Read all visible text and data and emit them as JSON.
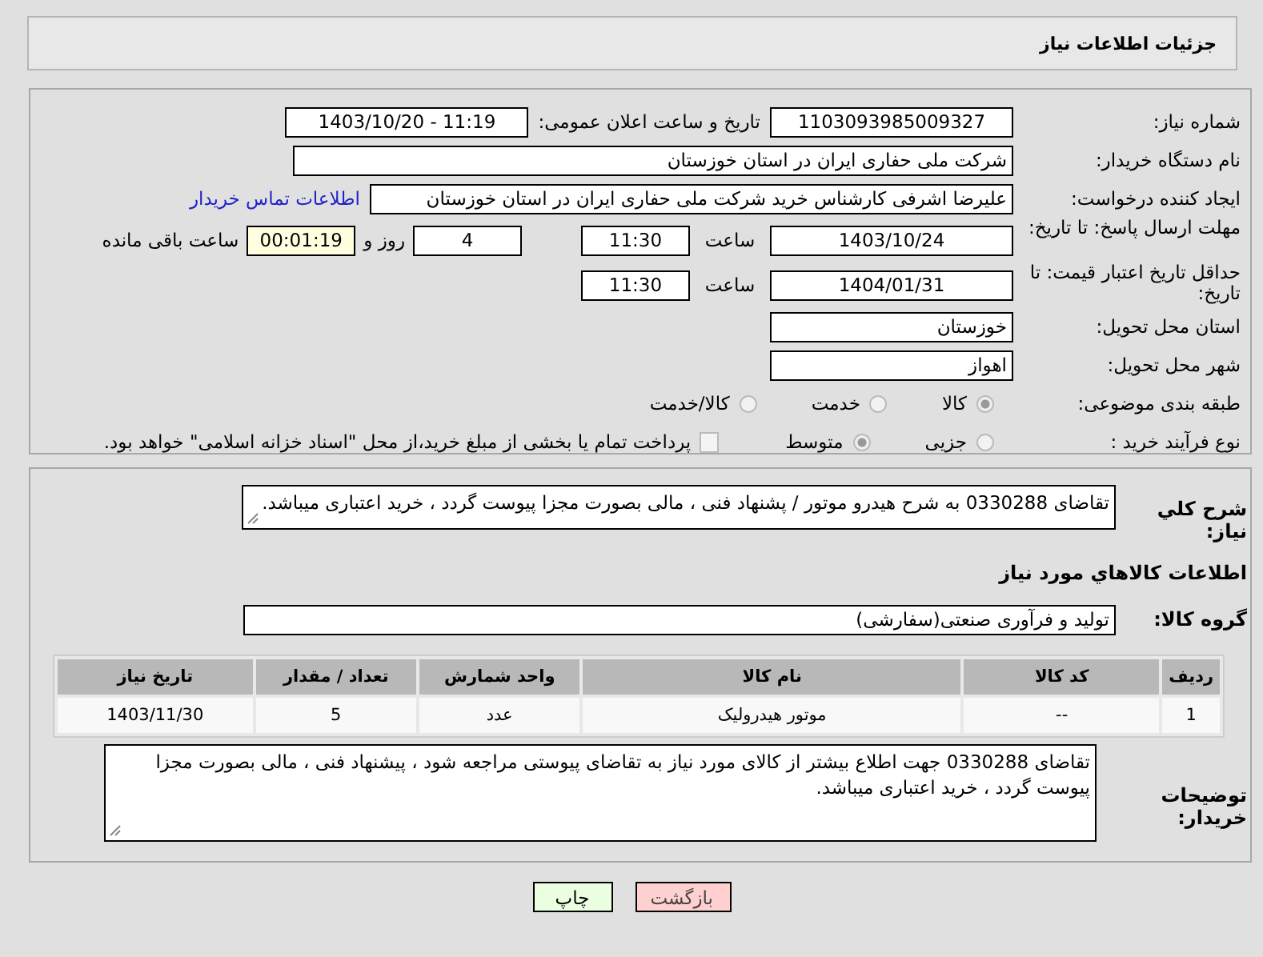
{
  "header": {
    "title": "جزئیات اطلاعات نیاز"
  },
  "details": {
    "need_number": {
      "label": "شماره نیاز:",
      "value": "1103093985009327"
    },
    "announce": {
      "label": "تاریخ و ساعت اعلان عمومی:",
      "value": "1403/10/20 - 11:19"
    },
    "buyer": {
      "label": "نام دستگاه خریدار:",
      "value": "شرکت ملی حفاری ایران در استان خوزستان"
    },
    "requester": {
      "label": "ایجاد کننده درخواست:",
      "value": "علیرضا اشرفی کارشناس خرید شرکت ملی حفاری ایران در استان خوزستان",
      "link": "اطلاعات تماس خریدار"
    },
    "deadline": {
      "label": "مهلت ارسال پاسخ: تا تاریخ:",
      "date": "1403/10/24",
      "time_label": "ساعت",
      "time": "11:30",
      "days": "4",
      "days_label": "روز و",
      "remaining": "00:01:19",
      "remaining_label": "ساعت باقی مانده"
    },
    "validity": {
      "label": "حداقل تاریخ اعتبار قیمت: تا تاریخ:",
      "date": "1404/01/31",
      "time_label": "ساعت",
      "time": "11:30"
    },
    "province": {
      "label": "استان محل تحویل:",
      "value": "خوزستان"
    },
    "city": {
      "label": "شهر محل تحویل:",
      "value": "اهواز"
    },
    "category": {
      "label": "طبقه بندی موضوعی:",
      "options": [
        {
          "label": "کالا",
          "selected": true
        },
        {
          "label": "خدمت",
          "selected": false
        },
        {
          "label": "کالا/خدمت",
          "selected": false
        }
      ]
    },
    "process": {
      "label": "نوع فرآیند خرید :",
      "options": [
        {
          "label": "جزیی",
          "selected": false
        },
        {
          "label": "متوسط",
          "selected": true
        }
      ],
      "payment": {
        "checked": false,
        "text": "پرداخت تمام یا بخشی از مبلغ خرید،از محل \"اسناد خزانه اسلامی\" خواهد بود."
      }
    }
  },
  "needs": {
    "description": {
      "label": "شرح کلي نیاز:",
      "value": "تقاضای 0330288 به شرح هیدرو موتور / پشنهاد فنی ، مالی بصورت مجزا پیوست گردد ، خرید اعتباری میباشد."
    },
    "section_title": "اطلاعات کالاهاي مورد نیاز",
    "group": {
      "label": "گروه کالا:",
      "value": "تولید و فرآوری صنعتی(سفارشی)"
    },
    "table": {
      "columns": [
        "ردیف",
        "کد کالا",
        "نام کالا",
        "واحد شمارش",
        "تعداد / مقدار",
        "تاریخ نیاز"
      ],
      "rows": [
        [
          "1",
          "--",
          "موتور هیدرولیک",
          "عدد",
          "5",
          "1403/11/30"
        ]
      ]
    },
    "notes": {
      "label": "توضیحات خریدار:",
      "value": "تقاضای 0330288 جهت اطلاع بیشتر از کالای مورد نیاز به تقاضای پیوستی مراجعه شود ، پیشنهاد فنی ، مالی بصورت مجزا پیوست گردد ، خرید اعتباری میباشد."
    }
  },
  "buttons": [
    {
      "label": "بازگشت",
      "kind": "back"
    },
    {
      "label": "چاپ",
      "kind": "print"
    }
  ]
}
